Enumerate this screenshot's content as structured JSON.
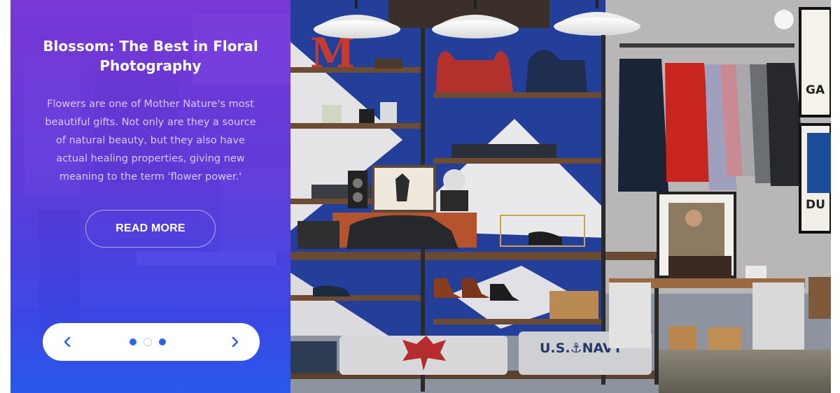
{
  "slide": {
    "title": "Blossom: The Best in Floral Photography",
    "description": "Flowers are one of Mother Nature's most beautiful gifts. Not only are they a source of natural beauty, but they also have actual healing properties, giving new meaning to the term 'flower power.'",
    "read_more_label": "READ MORE"
  },
  "navigation": {
    "prev_icon": "chevron-left-icon",
    "next_icon": "chevron-right-icon",
    "dots_count": 3,
    "active_dot": 2
  },
  "photo": {
    "sign_letter": "M",
    "sweater_text": "U.S.⚓NAVY",
    "poster_text_1": "GA",
    "poster_text_2": "DU"
  },
  "colors": {
    "gradient_top": "#7a36de",
    "gradient_bottom": "#2858f0",
    "accent": "#2b63e8",
    "white": "#ffffff"
  }
}
